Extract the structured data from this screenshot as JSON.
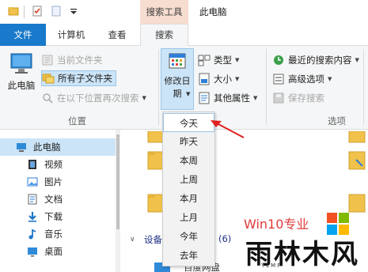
{
  "titlebar": {
    "contextual_tab_group": "搜索工具",
    "window_title": "此电脑"
  },
  "tabs": {
    "file": "文件",
    "computer": "计算机",
    "view": "查看",
    "search": "搜索"
  },
  "ribbon": {
    "location": {
      "this_pc": "此电脑",
      "current_folder": "当前文件夹",
      "all_subfolders": "所有子文件夹",
      "search_again_in": "在以下位置再次搜索",
      "group_label": "位置"
    },
    "refine": {
      "date_modified": "修改日期",
      "kind": "类型",
      "size": "大小",
      "other_properties": "其他属性"
    },
    "options": {
      "recent_searches": "最近的搜索内容",
      "advanced_options": "高级选项",
      "save_search": "保存搜索",
      "group_label": "选项"
    }
  },
  "nav": {
    "items": [
      {
        "label": "此电脑",
        "icon": "computer-icon"
      },
      {
        "label": "视频",
        "icon": "video-icon"
      },
      {
        "label": "图片",
        "icon": "picture-icon"
      },
      {
        "label": "文档",
        "icon": "document-icon"
      },
      {
        "label": "下载",
        "icon": "download-icon"
      },
      {
        "label": "音乐",
        "icon": "music-icon"
      },
      {
        "label": "桌面",
        "icon": "desktop-icon"
      }
    ]
  },
  "content": {
    "devices_header": "设备",
    "devices_count": "(6)",
    "drive_label": "百度网盘"
  },
  "date_dropdown": {
    "options": [
      "今天",
      "昨天",
      "本周",
      "上周",
      "本月",
      "上月",
      "今年",
      "去年"
    ],
    "highlighted": "今天"
  },
  "watermark": {
    "text": "Win10专业",
    "brand": "雨林木风",
    "sub": "YLMF"
  },
  "colors": {
    "file_tab": "#1979ca",
    "contextual_tab": "#f6ddd0",
    "accent": "#1979ca",
    "annotation_arrow": "#e02020"
  }
}
